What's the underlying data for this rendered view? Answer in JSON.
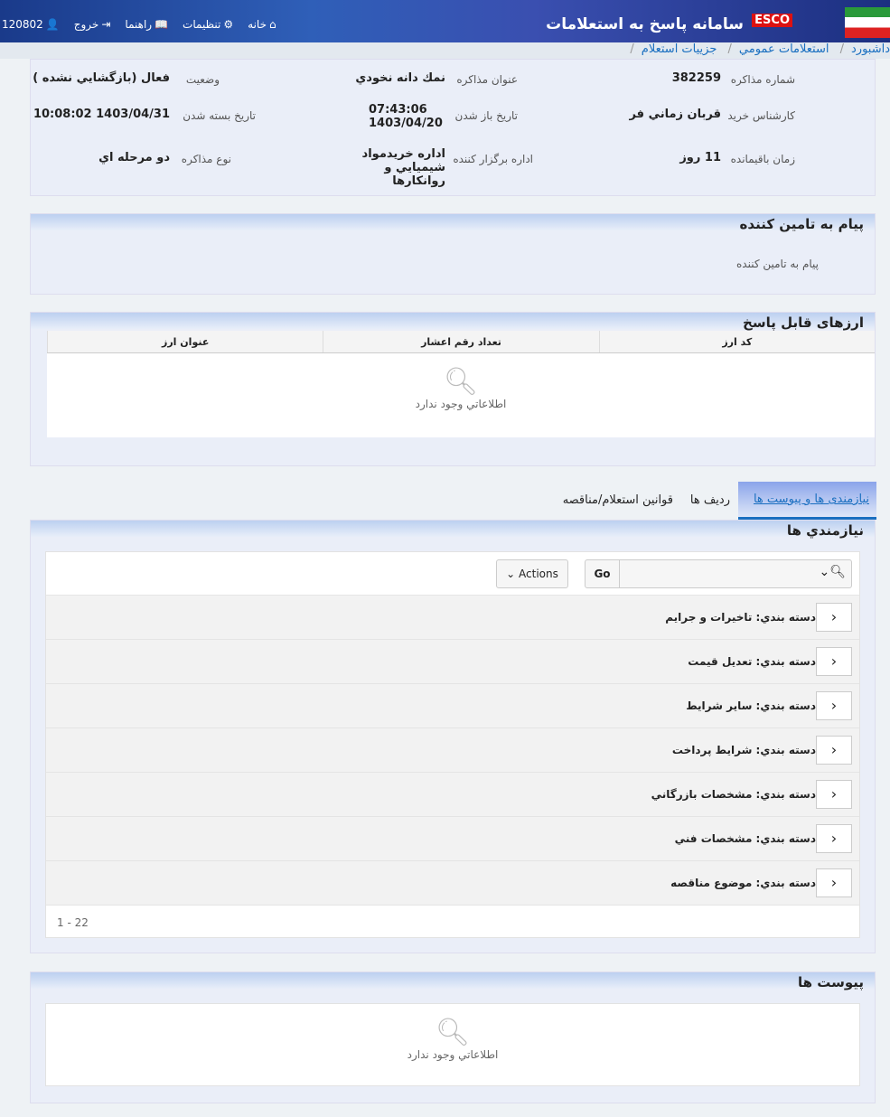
{
  "header": {
    "title": "سامانه پاسخ به استعلامات",
    "brand": "ESCO",
    "nav": [
      {
        "label": "خانه",
        "icon": "home-icon"
      },
      {
        "label": "تنظيمات",
        "icon": "gear-icon"
      },
      {
        "label": "راهنما",
        "icon": "book-icon"
      },
      {
        "label": "خروج",
        "icon": "logout-icon"
      },
      {
        "label": "120802",
        "icon": "user-icon"
      }
    ]
  },
  "breadcrumb": [
    "داشبورد",
    "استعلامات عمومي",
    "جزييات استعلام"
  ],
  "info": [
    {
      "label": "شماره مذاکره",
      "value": "382259"
    },
    {
      "label": "عنوان مذاکره",
      "value": "نمك دانه نخودي"
    },
    {
      "label": "وضعيت",
      "value": "فعال (بازگشايي نشده )"
    },
    {
      "label": "کارشناس خريد",
      "value": "قربان زماني فر"
    },
    {
      "label": "تاريخ باز شدن",
      "value": "07:43:06 1403/04/20"
    },
    {
      "label": "تاريخ بسته شدن",
      "value": "1403/04/31 10:08:02"
    },
    {
      "label": "زمان باقيمانده",
      "value": "11 روز"
    },
    {
      "label": "اداره برگزار کننده",
      "value": "اداره خريدمواد شيميايي و روانكارها"
    },
    {
      "label": "نوع مذاکره",
      "value": "دو مرحله اي"
    }
  ],
  "message": {
    "title": "پيام به تامين کننده",
    "label": "پيام به تامين کننده"
  },
  "currencies": {
    "title": "ارزهای قابل پاسخ",
    "columns": [
      "کد ارز",
      "تعداد رقم اعشار",
      "عنوان ارز"
    ],
    "empty": "اطلاعاتي وجود ندارد"
  },
  "tabs": [
    "نيازمندی ها و پیوست ها",
    "رديف ها",
    "قوانين استعلام/مناقصه"
  ],
  "requirements": {
    "title": "نيازمندي ها",
    "go": "Go",
    "actions": "Actions",
    "search_value": "",
    "rows": [
      "دسته بندي: تاخيرات و جرايم",
      "دسته بندي: تعديل قيمت",
      "دسته بندي: ساير شرايط",
      "دسته بندي: شرايط پرداخت",
      "دسته بندي: مشخصات بازرگاني",
      "دسته بندي: مشخصات فني",
      "دسته بندي: موضوع مناقصه"
    ],
    "pagination": "1 - 22"
  },
  "attachments": {
    "title": "پيوست ها",
    "empty": "اطلاعاتي وجود ندارد"
  }
}
